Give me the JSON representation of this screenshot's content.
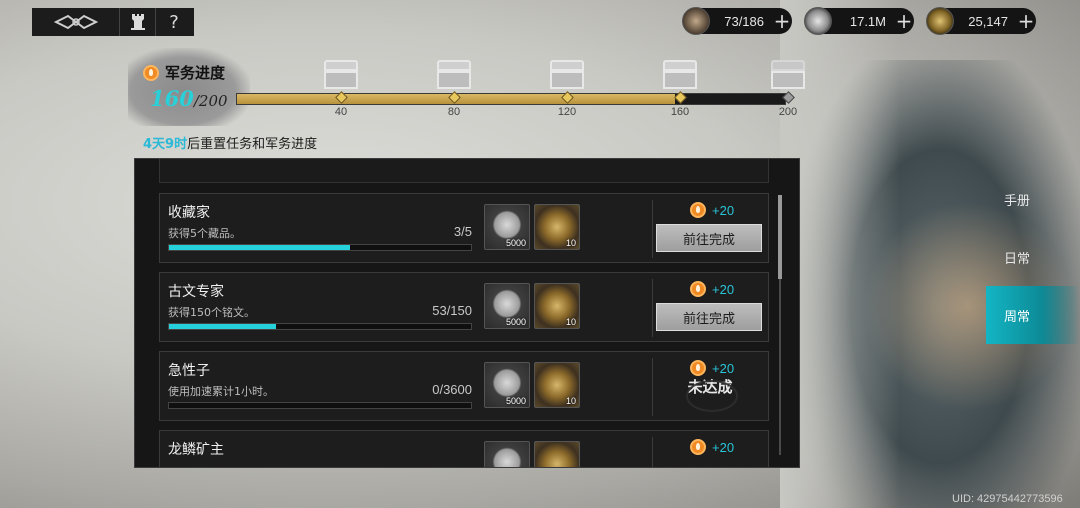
{
  "topbar": {
    "question_label": "?"
  },
  "resources": [
    {
      "icon": "gear-claw-icon",
      "value": "73/186"
    },
    {
      "icon": "silver-coin-icon",
      "value": "17.1M"
    },
    {
      "icon": "gold-ore-icon",
      "value": "25,147"
    }
  ],
  "progress": {
    "title": "军务进度",
    "current": "160",
    "max": "/200",
    "fraction": 0.8,
    "milestones": [
      {
        "label": "40",
        "reached": true
      },
      {
        "label": "80",
        "reached": true
      },
      {
        "label": "120",
        "reached": true
      },
      {
        "label": "160",
        "reached": true
      },
      {
        "label": "200",
        "reached": false
      }
    ],
    "reset_time": "4天9时",
    "reset_text": "后重置任务和军务进度"
  },
  "tasks": [
    {
      "name": "收藏家",
      "desc": "获得5个藏品。",
      "count": "3/5",
      "progress": 0.6,
      "rewards": [
        {
          "type": "silver-coin",
          "qty": "5000"
        },
        {
          "type": "gold-ore",
          "qty": "10"
        }
      ],
      "points": "+20",
      "action": "前往完成",
      "status": "go"
    },
    {
      "name": "古文专家",
      "desc": "获得150个铭文。",
      "count": "53/150",
      "progress": 0.353,
      "rewards": [
        {
          "type": "silver-coin",
          "qty": "5000"
        },
        {
          "type": "gold-ore",
          "qty": "10"
        }
      ],
      "points": "+20",
      "action": "前往完成",
      "status": "go"
    },
    {
      "name": "急性子",
      "desc": "使用加速累计1小时。",
      "count": "0/3600",
      "progress": 0,
      "rewards": [
        {
          "type": "silver-coin",
          "qty": "5000"
        },
        {
          "type": "gold-ore",
          "qty": "10"
        }
      ],
      "points": "+20",
      "action": "未达成",
      "status": "unmet"
    },
    {
      "name": "龙鳞矿主",
      "points": "+20"
    }
  ],
  "sidenav": [
    {
      "label": "手册",
      "active": false
    },
    {
      "label": "日常",
      "active": false
    },
    {
      "label": "周常",
      "active": true
    }
  ],
  "uid": "UID: 42975442773596"
}
